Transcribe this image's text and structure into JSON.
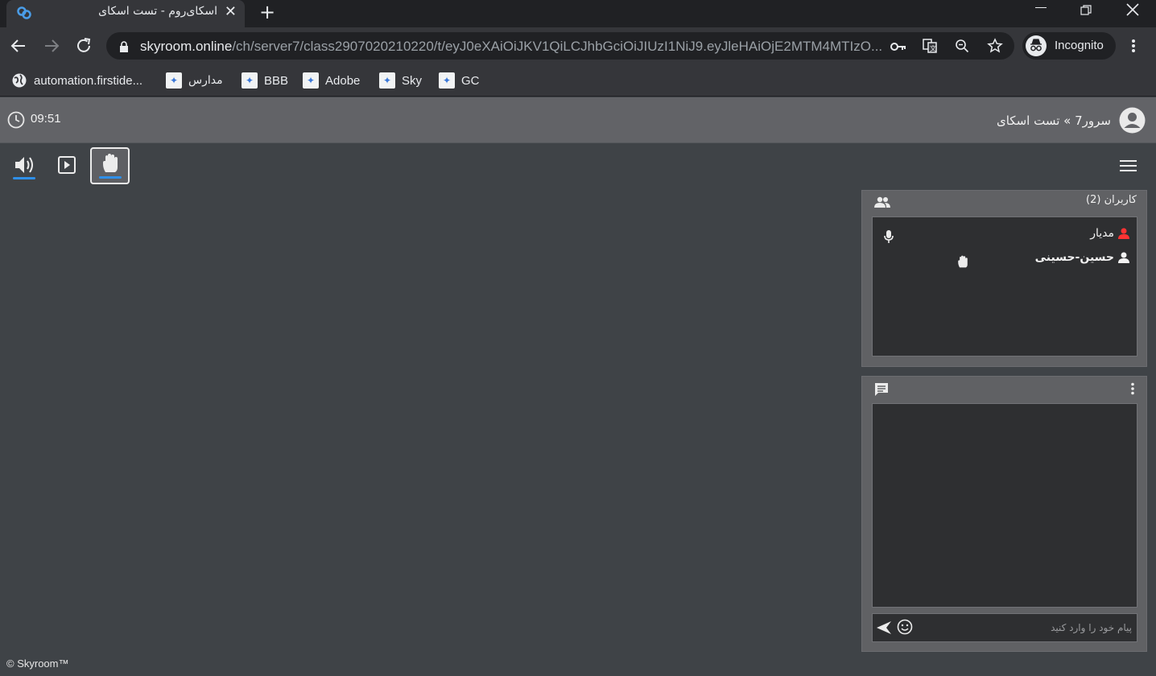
{
  "browser": {
    "tab_title": "اسکای‌روم - تست اسکای",
    "url_host": "skyroom.online",
    "url_path": "/ch/server7/class2907020210220/t/eyJ0eXAiOiJKV1QiLCJhbGciOiJIUzI1NiJ9.eyJleHAiOjE2MTM4MTIzO...",
    "incognito_label": "Incognito",
    "bookmarks": [
      {
        "label": "automation.firstide..."
      },
      {
        "label": "مدارس"
      },
      {
        "label": "BBB"
      },
      {
        "label": "Adobe"
      },
      {
        "label": "Sky"
      },
      {
        "label": "GC"
      }
    ]
  },
  "app": {
    "title": "سرور7 » تست اسکای",
    "clock": "09:51",
    "users_panel_title": "کاربران (2)",
    "users": [
      {
        "name": "مدیار",
        "role": "admin",
        "color": "#ff3333"
      },
      {
        "name": "حسین-حسینی",
        "role": "user",
        "color": "#f2f2f2"
      }
    ],
    "chat_placeholder": "پیام خود را وارد کنید",
    "footer": "© Skyroom™"
  },
  "colors": {
    "accent": "#2f8fe8",
    "admin": "#ff3333"
  }
}
